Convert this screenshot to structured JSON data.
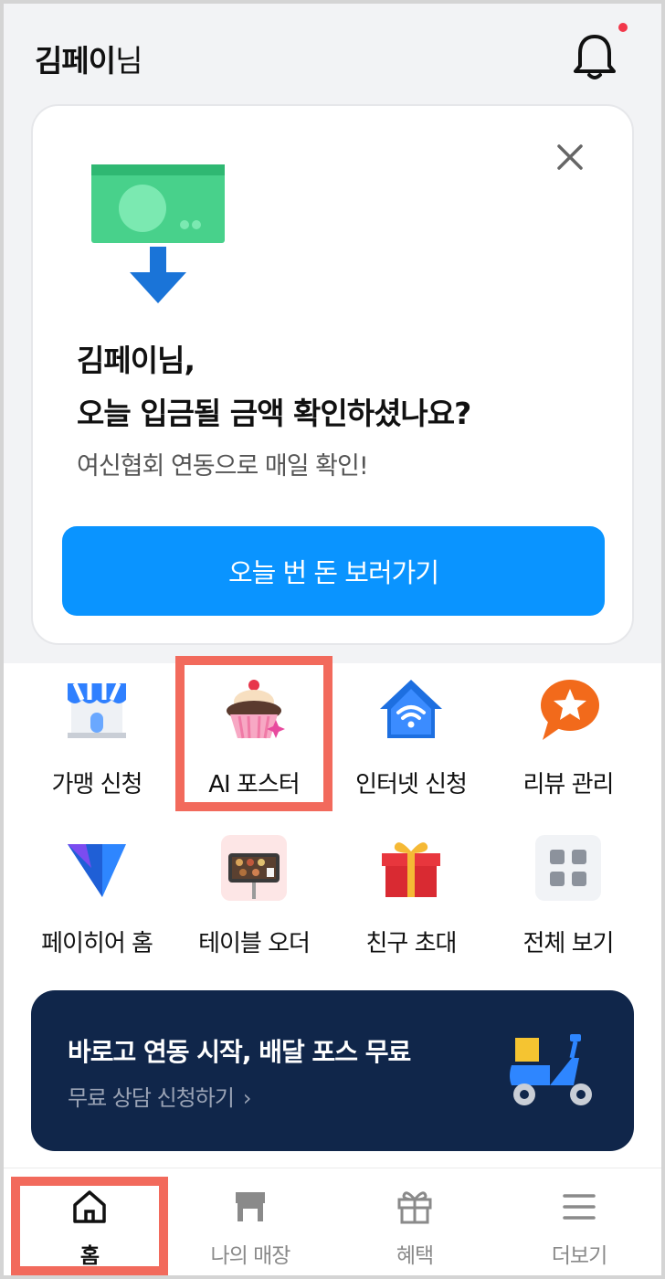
{
  "header": {
    "name": "김페이",
    "suffix": "님",
    "bell_icon": "bell-icon",
    "notification_color": "#f2374a"
  },
  "promo_card": {
    "title_line1": "김페이님,",
    "title_line2": "오늘 입금될 금액 확인하셨나요?",
    "subtitle": "여신협회 연동으로 매일 확인!",
    "button_label": "오늘 번 돈 보러가기",
    "button_color": "#0a94ff",
    "close_icon": "close-icon",
    "illustration": "money-download-icon"
  },
  "menu": {
    "items": [
      {
        "label": "가맹 신청",
        "icon": "store-icon"
      },
      {
        "label": "AI 포스터",
        "icon": "cupcake-icon"
      },
      {
        "label": "인터넷 신청",
        "icon": "wifi-house-icon"
      },
      {
        "label": "리뷰 관리",
        "icon": "review-star-icon"
      },
      {
        "label": "페이히어 홈",
        "icon": "payhere-logo-icon"
      },
      {
        "label": "테이블 오더",
        "icon": "table-order-icon"
      },
      {
        "label": "친구 초대",
        "icon": "gift-icon"
      },
      {
        "label": "전체 보기",
        "icon": "grid-icon"
      }
    ]
  },
  "banner": {
    "title": "바로고 연동 시작, 배달 포스 무료",
    "subtitle": "무료 상담 신청하기",
    "background": "#10264a",
    "icon": "delivery-scooter-icon"
  },
  "tabbar": {
    "tabs": [
      {
        "label": "홈",
        "icon": "home-icon",
        "active": true
      },
      {
        "label": "나의 매장",
        "icon": "store-icon",
        "active": false
      },
      {
        "label": "혜택",
        "icon": "gift-icon",
        "active": false
      },
      {
        "label": "더보기",
        "icon": "menu-icon",
        "active": false
      }
    ]
  },
  "highlight_color": "#f26a5c"
}
